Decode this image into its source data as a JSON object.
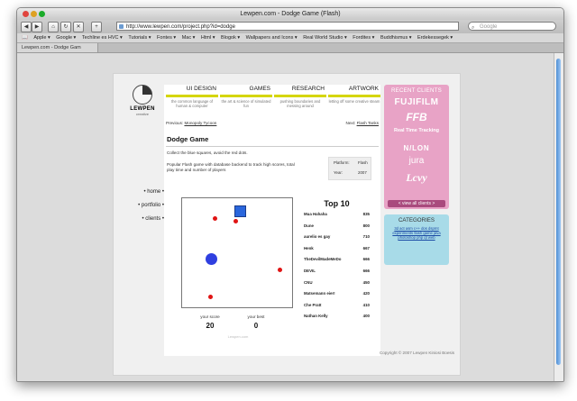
{
  "browser": {
    "title": "Lewpen.com - Dodge Game (Flash)",
    "url": "http://www.lewpen.com/project.php?id=dodge",
    "search_placeholder": "Google",
    "bookmarks": [
      "Apple ▾",
      "Google ▾",
      "Techline es HVC ▾",
      "Tutorials ▾",
      "Fontes ▾",
      "Mac ▾",
      "Html ▾",
      "Blogok ▾",
      "Wallpapers and Icons ▾",
      "Real World Studio ▾",
      "Fordites ▾",
      "Buddhismus ▾",
      "Erdekessegek ▾"
    ],
    "tab_label": "Lewpen.com - Dodge Gam"
  },
  "site": {
    "logo_name": "LEWPEN",
    "logo_sub": "creative",
    "nav": [
      "• home •",
      "• portfolio •",
      "• clients •"
    ],
    "menu": [
      {
        "title": "UI DESIGN",
        "desc": "the common language of human & computer"
      },
      {
        "title": "GAMES",
        "desc": "the art & science of simulated fun"
      },
      {
        "title": "RESEARCH",
        "desc": "pushing boundaries and messing around"
      },
      {
        "title": "ARTWORK",
        "desc": "letting off some creative steam"
      }
    ],
    "previous_label": "Previous:",
    "previous_link": "Monopoly Tycoon",
    "next_label": "Next:",
    "next_link": "Flash Tanks",
    "project_title": "Dodge Game",
    "description_1": "Collect the blue squares, avoid the red dots.",
    "description_2": "Popular Flash game with database backend to track high scores, total play time and number of players",
    "platform_label": "Platform:",
    "platform_value": "Flash",
    "year_label": "Year:",
    "year_value": "2007",
    "your_score_label": "your score",
    "your_score": "20",
    "your_best_label": "your best",
    "your_best": "0",
    "watermark": "Lewpen.com",
    "top10_title": "Top 10",
    "high_scores": [
      {
        "name": "Mua Hahaha",
        "score": "835"
      },
      {
        "name": "Dune",
        "score": "800"
      },
      {
        "name": "aurelio es gay",
        "score": "710"
      },
      {
        "name": "Henk",
        "score": "667"
      },
      {
        "name": "TheDevilMadeMeDo",
        "score": "666"
      },
      {
        "name": "DEVIL",
        "score": "666"
      },
      {
        "name": "CNU",
        "score": "450"
      },
      {
        "name": "Matsemann eier!",
        "score": "420"
      },
      {
        "name": "Che Pratt",
        "score": "410"
      },
      {
        "name": "Nathan Kelly",
        "score": "400"
      }
    ],
    "copyright": "Copyright © 2007 Lewpen Kiniosi Boesis",
    "recent_clients_title": "RECENT CLIENTS",
    "clients": [
      "FUJIFILM",
      "FFB",
      "Real Time Tracking",
      "N/LON",
      "jura",
      "Lcvy"
    ],
    "view_all_clients": "< view all clients >",
    "categories_title": "CATEGORIES",
    "categories_tags": "3d act asm c++ dos dsprnt experiments flash game java photoshop php qt web"
  }
}
